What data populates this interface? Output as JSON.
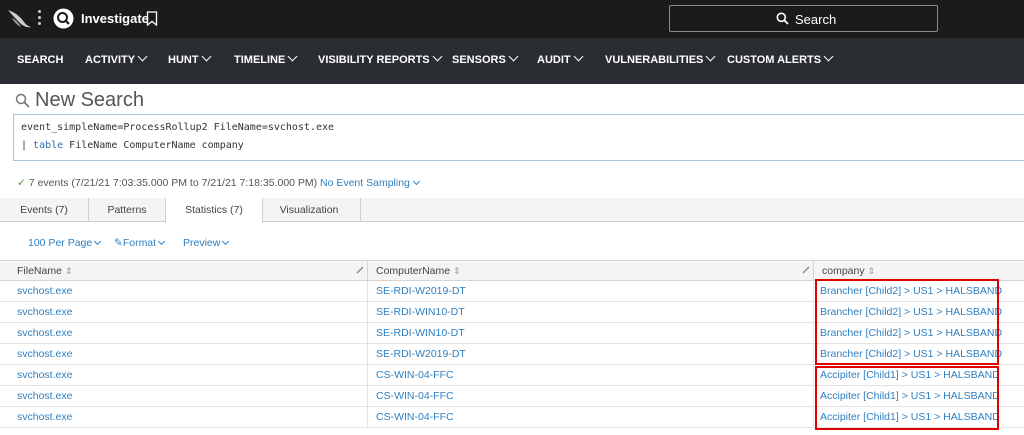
{
  "topbar": {
    "app_title": "Investigate",
    "search_label": "Search",
    "icons": [
      "falcon-logo-icon",
      "kebab-menu-icon",
      "investigate-app-icon",
      "bookmark-icon",
      "search-icon"
    ]
  },
  "nav": {
    "items": [
      {
        "label": "SEARCH",
        "has_menu": false
      },
      {
        "label": "ACTIVITY",
        "has_menu": true
      },
      {
        "label": "HUNT",
        "has_menu": true
      },
      {
        "label": "TIMELINE",
        "has_menu": true
      },
      {
        "label": "VISIBILITY REPORTS",
        "has_menu": true
      },
      {
        "label": "SENSORS",
        "has_menu": true
      },
      {
        "label": "AUDIT",
        "has_menu": true
      },
      {
        "label": "VULNERABILITIES",
        "has_menu": true
      },
      {
        "label": "CUSTOM ALERTS",
        "has_menu": true
      }
    ]
  },
  "page": {
    "title": "New Search"
  },
  "query": {
    "line1": "event_simpleName=ProcessRollup2 FileName=svchost.exe",
    "line2_pipe": "| ",
    "line2_keyword": "table",
    "line2_rest": " FileName ComputerName company"
  },
  "status": {
    "check": "✓",
    "text": "7 events (7/21/21 7:03:35.000 PM to 7/21/21 7:18:35.000 PM)",
    "sampling": "No Event Sampling"
  },
  "tabs": [
    {
      "label": "Events (7)",
      "active": false
    },
    {
      "label": "Patterns",
      "active": false
    },
    {
      "label": "Statistics (7)",
      "active": true
    },
    {
      "label": "Visualization",
      "active": false
    }
  ],
  "toolbar": {
    "per_page": "100 Per Page",
    "format": "Format",
    "preview": "Preview"
  },
  "table": {
    "columns": [
      "FileName",
      "ComputerName",
      "company"
    ],
    "sort_glyph": "⇕",
    "rows": [
      [
        "svchost.exe",
        "SE-RDI-W2019-DT",
        "Brancher [Child2] > US1 > HALSBAND"
      ],
      [
        "svchost.exe",
        "SE-RDI-WIN10-DT",
        "Brancher [Child2] > US1 > HALSBAND"
      ],
      [
        "svchost.exe",
        "SE-RDI-WIN10-DT",
        "Brancher [Child2] > US1 > HALSBAND"
      ],
      [
        "svchost.exe",
        "SE-RDI-W2019-DT",
        "Brancher [Child2] > US1 > HALSBAND"
      ],
      [
        "svchost.exe",
        "CS-WIN-04-FFC",
        "Accipiter [Child1] > US1 > HALSBAND"
      ],
      [
        "svchost.exe",
        "CS-WIN-04-FFC",
        "Accipiter [Child1] > US1 > HALSBAND"
      ],
      [
        "svchost.exe",
        "CS-WIN-04-FFC",
        "Accipiter [Child1] > US1 > HALSBAND"
      ]
    ]
  },
  "colors": {
    "topbar_bg": "#1b1b1b",
    "navbar_bg": "#2a2d31",
    "link": "#2f7fc0",
    "highlight": "#e00000"
  }
}
